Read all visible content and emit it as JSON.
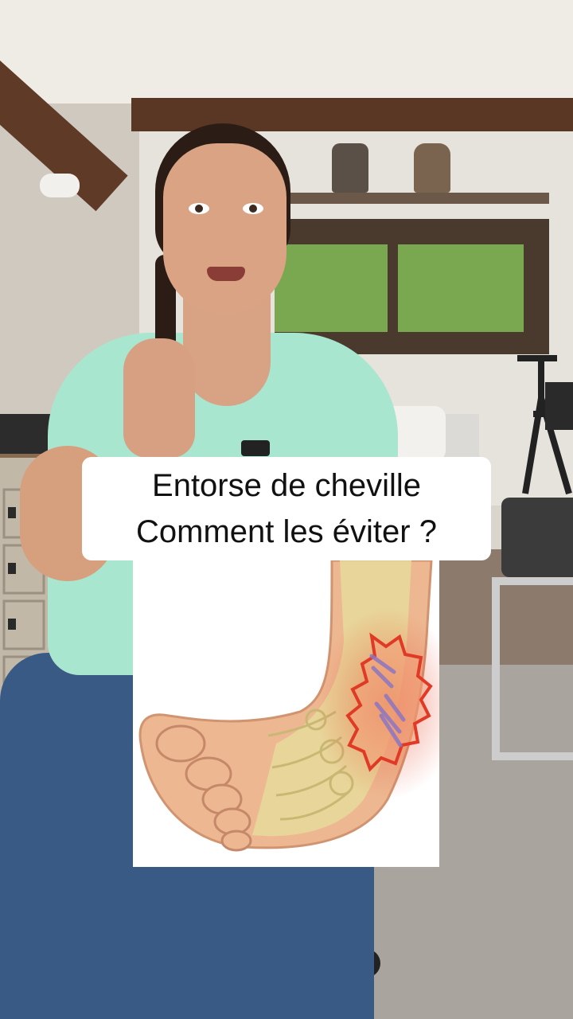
{
  "caption": {
    "line1": "Entorse de cheville",
    "line2": "Comment les éviter ?"
  },
  "illustration": {
    "subject": "ankle-sprain-foot-diagram",
    "colors": {
      "skin": "#edb891",
      "bones": "#e6d99a",
      "inflammation": "#e8553a",
      "ligament": "#8c76c2"
    }
  }
}
